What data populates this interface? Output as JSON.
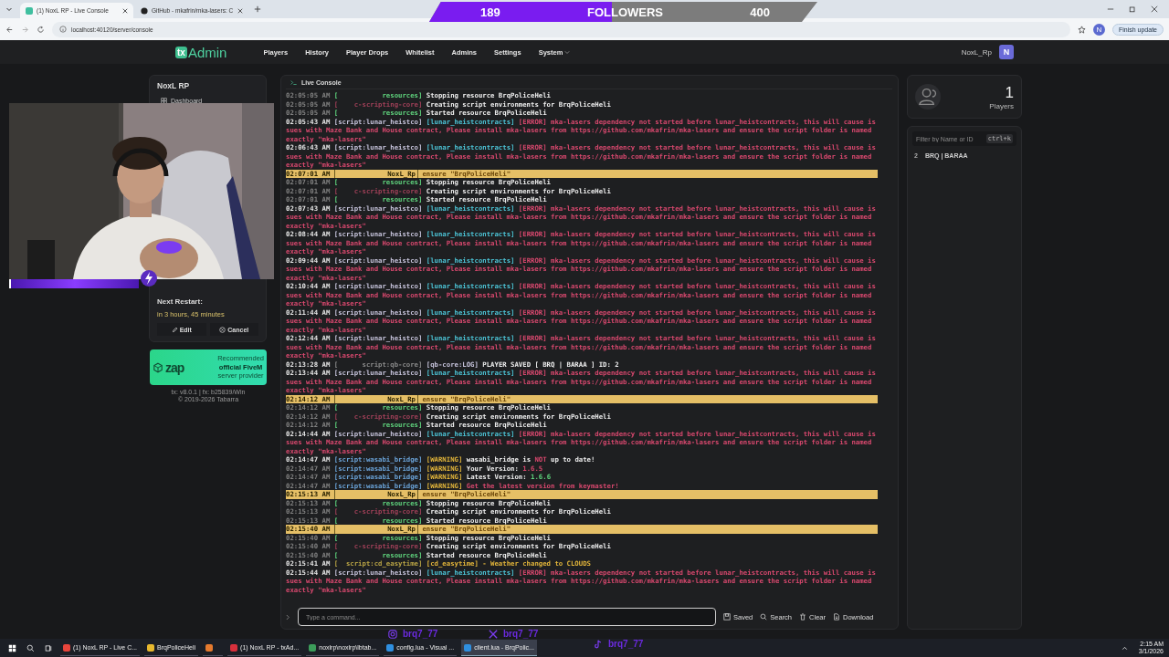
{
  "browser": {
    "tabs": [
      {
        "label": "(1) NoxL RP - Live Console",
        "selected": true
      },
      {
        "label": "GitHub - mkafrin/mka-lasers: C",
        "selected": false
      }
    ],
    "address": "localhost:40120/server/console",
    "profile": "N",
    "update_button": "Finish update"
  },
  "follower_goal": {
    "current": "189",
    "label": "FOLLOWERS",
    "goal": "400",
    "level": 0.47
  },
  "header": {
    "logo_mark": "tx",
    "logo_text": "Admin",
    "nav": [
      {
        "label": "Players",
        "dropdown": false
      },
      {
        "label": "History",
        "dropdown": false
      },
      {
        "label": "Player Drops",
        "dropdown": false
      },
      {
        "label": "Whitelist",
        "dropdown": false
      },
      {
        "label": "Admins",
        "dropdown": false
      },
      {
        "label": "Settings",
        "dropdown": false
      },
      {
        "label": "System",
        "dropdown": true
      }
    ],
    "user": "NoxL_Rp",
    "avatar": "N"
  },
  "sidebar": {
    "server_name": "NoxL RP",
    "items": [
      {
        "label": "Dashboard",
        "selected": false
      }
    ],
    "restart": {
      "title": "Next Restart:",
      "when": "in 3 hours, 45 minutes",
      "buttons": [
        "Edit",
        "Cancel"
      ]
    },
    "ad": {
      "logo": "zap",
      "lines": [
        "Recommended",
        "official FiveM",
        "server provider"
      ]
    },
    "footer": [
      "tx: v8.0.1 | fx: b25839/Win",
      "© 2019-2026 Tabarra"
    ]
  },
  "console": {
    "title": "Live Console",
    "lines": [
      {
        "kind": "log",
        "time": "02:05:05 AM",
        "faded": true,
        "source": {
          "text": "[           resources]",
          "kind": "green"
        },
        "segments": [
          {
            "text": "Stopping resource BrqPoliceHeli",
            "kind": "white"
          }
        ]
      },
      {
        "kind": "log",
        "time": "02:05:05 AM",
        "faded": true,
        "source": {
          "text": "[    c-scripting-core]",
          "kind": "dimred"
        },
        "segments": [
          {
            "text": "Creating script environments for BrqPoliceHeli",
            "kind": "white"
          }
        ]
      },
      {
        "kind": "log",
        "time": "02:05:05 AM",
        "faded": true,
        "source": {
          "text": "[           resources]",
          "kind": "green"
        },
        "segments": [
          {
            "text": "Started resource BrqPoliceHeli",
            "kind": "white"
          }
        ]
      },
      {
        "kind": "log",
        "time": "02:05:43 AM",
        "faded": false,
        "source": {
          "text": "[script:lunar_heistco]",
          "kind": "lavender"
        },
        "segments": [
          {
            "text": "[lunar_heistcontracts]",
            "kind": "cyan"
          },
          {
            "text": "[ERROR] mka-lasers dependency not started before lunar_heistcontracts, this will cause issues with Maze Bank and House contract, Please install mka-lasers from https://github.com/mkafrin/mka-lasers and ensure the script folder is named exactly \"mka-lasers\"",
            "kind": "red"
          }
        ]
      },
      {
        "kind": "log",
        "time": "02:06:43 AM",
        "faded": false,
        "source": {
          "text": "[script:lunar_heistco]",
          "kind": "lavender"
        },
        "segments": [
          {
            "text": "[lunar_heistcontracts]",
            "kind": "cyan"
          },
          {
            "text": "[ERROR] mka-lasers dependency not started before lunar_heistcontracts, this will cause issues with Maze Bank and House contract, Please install mka-lasers from https://github.com/mkafrin/mka-lasers and ensure the script folder is named exactly \"mka-lasers\"",
            "kind": "red"
          }
        ]
      },
      {
        "kind": "command",
        "time": "02:07:01 AM",
        "source": {
          "text": "NoxL_Rp",
          "kind": "dark"
        },
        "segments": [
          {
            "text": "ensure \"BrqPoliceHeli\"",
            "kind": "brown"
          }
        ]
      },
      {
        "kind": "log",
        "time": "02:07:01 AM",
        "faded": true,
        "source": {
          "text": "[           resources]",
          "kind": "green"
        },
        "segments": [
          {
            "text": "Stopping resource BrqPoliceHeli",
            "kind": "white"
          }
        ]
      },
      {
        "kind": "log",
        "time": "02:07:01 AM",
        "faded": true,
        "source": {
          "text": "[    c-scripting-core]",
          "kind": "dimred"
        },
        "segments": [
          {
            "text": "Creating script environments for BrqPoliceHeli",
            "kind": "white"
          }
        ]
      },
      {
        "kind": "log",
        "time": "02:07:01 AM",
        "faded": true,
        "source": {
          "text": "[           resources]",
          "kind": "green"
        },
        "segments": [
          {
            "text": "Started resource BrqPoliceHeli",
            "kind": "white"
          }
        ]
      },
      {
        "kind": "log",
        "time": "02:07:43 AM",
        "faded": false,
        "source": {
          "text": "[script:lunar_heistco]",
          "kind": "lavender"
        },
        "segments": [
          {
            "text": "[lunar_heistcontracts]",
            "kind": "cyan"
          },
          {
            "text": "[ERROR] mka-lasers dependency not started before lunar_heistcontracts, this will cause issues with Maze Bank and House contract, Please install mka-lasers from https://github.com/mkafrin/mka-lasers and ensure the script folder is named exactly \"mka-lasers\"",
            "kind": "red"
          }
        ]
      },
      {
        "kind": "log",
        "time": "02:08:44 AM",
        "faded": false,
        "source": {
          "text": "[script:lunar_heistco]",
          "kind": "lavender"
        },
        "segments": [
          {
            "text": "[lunar_heistcontracts]",
            "kind": "cyan"
          },
          {
            "text": "[ERROR] mka-lasers dependency not started before lunar_heistcontracts, this will cause issues with Maze Bank and House contract, Please install mka-lasers from https://github.com/mkafrin/mka-lasers and ensure the script folder is named exactly \"mka-lasers\"",
            "kind": "red"
          }
        ]
      },
      {
        "kind": "log",
        "time": "02:09:44 AM",
        "faded": false,
        "source": {
          "text": "[script:lunar_heistco]",
          "kind": "lavender"
        },
        "segments": [
          {
            "text": "[lunar_heistcontracts]",
            "kind": "cyan"
          },
          {
            "text": "[ERROR] mka-lasers dependency not started before lunar_heistcontracts, this will cause issues with Maze Bank and House contract, Please install mka-lasers from https://github.com/mkafrin/mka-lasers and ensure the script folder is named exactly \"mka-lasers\"",
            "kind": "red"
          }
        ]
      },
      {
        "kind": "log",
        "time": "02:10:44 AM",
        "faded": false,
        "source": {
          "text": "[script:lunar_heistco]",
          "kind": "lavender"
        },
        "segments": [
          {
            "text": "[lunar_heistcontracts]",
            "kind": "cyan"
          },
          {
            "text": "[ERROR] mka-lasers dependency not started before lunar_heistcontracts, this will cause issues with Maze Bank and House contract, Please install mka-lasers from https://github.com/mkafrin/mka-lasers and ensure the script folder is named exactly \"mka-lasers\"",
            "kind": "red"
          }
        ]
      },
      {
        "kind": "log",
        "time": "02:11:44 AM",
        "faded": false,
        "source": {
          "text": "[script:lunar_heistco]",
          "kind": "lavender"
        },
        "segments": [
          {
            "text": "[lunar_heistcontracts]",
            "kind": "cyan"
          },
          {
            "text": "[ERROR] mka-lasers dependency not started before lunar_heistcontracts, this will cause issues with Maze Bank and House contract, Please install mka-lasers from https://github.com/mkafrin/mka-lasers and ensure the script folder is named exactly \"mka-lasers\"",
            "kind": "red"
          }
        ]
      },
      {
        "kind": "log",
        "time": "02:12:44 AM",
        "faded": false,
        "source": {
          "text": "[script:lunar_heistco]",
          "kind": "lavender"
        },
        "segments": [
          {
            "text": "[lunar_heistcontracts]",
            "kind": "cyan"
          },
          {
            "text": "[ERROR] mka-lasers dependency not started before lunar_heistcontracts, this will cause issues with Maze Bank and House contract, Please install mka-lasers from https://github.com/mkafrin/mka-lasers and ensure the script folder is named exactly \"mka-lasers\"",
            "kind": "red"
          }
        ]
      },
      {
        "kind": "log",
        "time": "02:13:28 AM",
        "faded": false,
        "source": {
          "text": "[      script:qb-core]",
          "kind": "dim"
        },
        "segments": [
          {
            "text": "[qb-core:LOG]",
            "kind": "lavender"
          },
          {
            "text": "PLAYER SAVED [ BRQ | BARAA ] ID: 2",
            "kind": "white"
          }
        ]
      },
      {
        "kind": "log",
        "time": "02:13:44 AM",
        "faded": false,
        "source": {
          "text": "[script:lunar_heistco]",
          "kind": "lavender"
        },
        "segments": [
          {
            "text": "[lunar_heistcontracts]",
            "kind": "cyan"
          },
          {
            "text": "[ERROR] mka-lasers dependency not started before lunar_heistcontracts, this will cause issues with Maze Bank and House contract, Please install mka-lasers from https://github.com/mkafrin/mka-lasers and ensure the script folder is named exactly \"mka-lasers\"",
            "kind": "red"
          }
        ]
      },
      {
        "kind": "command",
        "time": "02:14:12 AM",
        "source": {
          "text": "NoxL_Rp",
          "kind": "dark"
        },
        "segments": [
          {
            "text": "ensure \"BrqPoliceHeli\"",
            "kind": "brown"
          }
        ]
      },
      {
        "kind": "log",
        "time": "02:14:12 AM",
        "faded": true,
        "source": {
          "text": "[           resources]",
          "kind": "green"
        },
        "segments": [
          {
            "text": "Stopping resource BrqPoliceHeli",
            "kind": "white"
          }
        ]
      },
      {
        "kind": "log",
        "time": "02:14:12 AM",
        "faded": true,
        "source": {
          "text": "[    c-scripting-core]",
          "kind": "dimred"
        },
        "segments": [
          {
            "text": "Creating script environments for BrqPoliceHeli",
            "kind": "white"
          }
        ]
      },
      {
        "kind": "log",
        "time": "02:14:12 AM",
        "faded": true,
        "source": {
          "text": "[           resources]",
          "kind": "green"
        },
        "segments": [
          {
            "text": "Started resource BrqPoliceHeli",
            "kind": "white"
          }
        ]
      },
      {
        "kind": "log",
        "time": "02:14:44 AM",
        "faded": false,
        "source": {
          "text": "[script:lunar_heistco]",
          "kind": "lavender"
        },
        "segments": [
          {
            "text": "[lunar_heistcontracts]",
            "kind": "cyan"
          },
          {
            "text": "[ERROR] mka-lasers dependency not started before lunar_heistcontracts, this will cause issues with Maze Bank and House contract, Please install mka-lasers from https://github.com/mkafrin/mka-lasers and ensure the script folder is named exactly \"mka-lasers\"",
            "kind": "red"
          }
        ]
      },
      {
        "kind": "log",
        "time": "02:14:47 AM",
        "faded": false,
        "source": {
          "text": "[script:wasabi_bridge]",
          "kind": "blue"
        },
        "segments": [
          {
            "text": "[WARNING]",
            "kind": "yellow"
          },
          {
            "text": "wasabi_bridge is",
            "kind": "white"
          },
          {
            "text": "NOT",
            "kind": "red"
          },
          {
            "text": "up to date!",
            "kind": "white"
          }
        ]
      },
      {
        "kind": "log",
        "time": "02:14:47 AM",
        "faded": true,
        "source": {
          "text": "[script:wasabi_bridge]",
          "kind": "blue"
        },
        "segments": [
          {
            "text": "[WARNING]",
            "kind": "yellow"
          },
          {
            "text": "Your Version:",
            "kind": "white"
          },
          {
            "text": "1.6.5",
            "kind": "red"
          }
        ]
      },
      {
        "kind": "log",
        "time": "02:14:47 AM",
        "faded": true,
        "source": {
          "text": "[script:wasabi_bridge]",
          "kind": "blue"
        },
        "segments": [
          {
            "text": "[WARNING]",
            "kind": "yellow"
          },
          {
            "text": "Latest Version:",
            "kind": "white"
          },
          {
            "text": "1.6.6",
            "kind": "green"
          }
        ]
      },
      {
        "kind": "log",
        "time": "02:14:47 AM",
        "faded": true,
        "source": {
          "text": "[script:wasabi_bridge]",
          "kind": "blue"
        },
        "segments": [
          {
            "text": "[WARNING]",
            "kind": "yellow"
          },
          {
            "text": "Get the latest version from keymaster!",
            "kind": "red"
          }
        ]
      },
      {
        "kind": "command",
        "time": "02:15:13 AM",
        "source": {
          "text": "NoxL_Rp",
          "kind": "dark"
        },
        "segments": [
          {
            "text": "ensure \"BrqPoliceHeli\"",
            "kind": "brown"
          }
        ]
      },
      {
        "kind": "log",
        "time": "02:15:13 AM",
        "faded": true,
        "source": {
          "text": "[           resources]",
          "kind": "green"
        },
        "segments": [
          {
            "text": "Stopping resource BrqPoliceHeli",
            "kind": "white"
          }
        ]
      },
      {
        "kind": "log",
        "time": "02:15:13 AM",
        "faded": true,
        "source": {
          "text": "[    c-scripting-core]",
          "kind": "dimred"
        },
        "segments": [
          {
            "text": "Creating script environments for BrqPoliceHeli",
            "kind": "white"
          }
        ]
      },
      {
        "kind": "log",
        "time": "02:15:13 AM",
        "faded": true,
        "source": {
          "text": "[           resources]",
          "kind": "green"
        },
        "segments": [
          {
            "text": "Started resource BrqPoliceHeli",
            "kind": "white"
          }
        ]
      },
      {
        "kind": "command",
        "time": "02:15:40 AM",
        "source": {
          "text": "NoxL_Rp",
          "kind": "dark"
        },
        "segments": [
          {
            "text": "ensure \"BrqPoliceHeli\"",
            "kind": "brown"
          }
        ]
      },
      {
        "kind": "log",
        "time": "02:15:40 AM",
        "faded": true,
        "source": {
          "text": "[           resources]",
          "kind": "green"
        },
        "segments": [
          {
            "text": "Stopping resource BrqPoliceHeli",
            "kind": "white"
          }
        ]
      },
      {
        "kind": "log",
        "time": "02:15:40 AM",
        "faded": true,
        "source": {
          "text": "[    c-scripting-core]",
          "kind": "dimred"
        },
        "segments": [
          {
            "text": "Creating script environments for BrqPoliceHeli",
            "kind": "white"
          }
        ]
      },
      {
        "kind": "log",
        "time": "02:15:40 AM",
        "faded": true,
        "source": {
          "text": "[           resources]",
          "kind": "green"
        },
        "segments": [
          {
            "text": "Started resource BrqPoliceHeli",
            "kind": "white"
          }
        ]
      },
      {
        "kind": "log",
        "time": "02:15:41 AM",
        "faded": false,
        "source": {
          "text": "[  script:cd_easytime]",
          "kind": "olive"
        },
        "segments": [
          {
            "text": "[cd_easytime] - Weather changed to CLOUDS",
            "kind": "yellow"
          }
        ]
      },
      {
        "kind": "log",
        "time": "02:15:44 AM",
        "faded": false,
        "source": {
          "text": "[script:lunar_heistco]",
          "kind": "lavender"
        },
        "segments": [
          {
            "text": "[lunar_heistcontracts]",
            "kind": "cyan"
          },
          {
            "text": "[ERROR] mka-lasers dependency not started before lunar_heistcontracts, this will cause issues with Maze Bank and House contract, Please install mka-lasers from https://github.com/mkafrin/mka-lasers and ensure the script folder is named exactly \"mka-lasers\"",
            "kind": "red"
          }
        ]
      }
    ],
    "input": {
      "placeholder": "Type a command..."
    },
    "actions": [
      "Saved",
      "Search",
      "Clear",
      "Download"
    ]
  },
  "players": {
    "count": "1",
    "label": "Players",
    "filter": {
      "placeholder": "Filter by Name or ID",
      "shortcut": "ctrl+k"
    },
    "list": [
      {
        "id": "2",
        "name": "BRQ | BARAA"
      }
    ]
  },
  "socials": [
    "brq7_77",
    "brq7_77",
    "brq7_77"
  ],
  "taskbar": {
    "apps": [
      {
        "label": "(1) NoxL RP - Live C...",
        "selected": false
      },
      {
        "label": "BrqPoliceHeli",
        "selected": false
      },
      {
        "selected": false
      },
      {
        "label": "(1) NoxL RP - txAd...",
        "selected": false
      },
      {
        "label": "noxlrp\\noxlrp\\lbtab...",
        "selected": false
      },
      {
        "label": "config.lua - Visual ...",
        "selected": false
      },
      {
        "label": "client.lua - BrqPolic...",
        "selected": true
      }
    ],
    "time": "2:15 AM",
    "date": "3/1/2026"
  }
}
